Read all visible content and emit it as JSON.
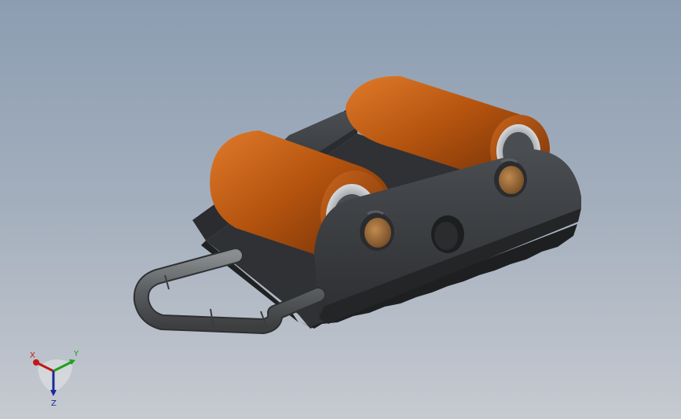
{
  "view": {
    "background_top": "#8c9db2",
    "background_bottom": "#c6cad1"
  },
  "model": {
    "roller_color": "#b5540f",
    "frame_color": "#3a3d40",
    "bushing_color": "#a8743d",
    "handle_color": "#5a5d60"
  },
  "triad": {
    "x_label": "X",
    "y_label": "Y",
    "z_label": "Z",
    "x_color": "#c01818",
    "y_color": "#20a020",
    "z_color": "#1a2a9a"
  }
}
